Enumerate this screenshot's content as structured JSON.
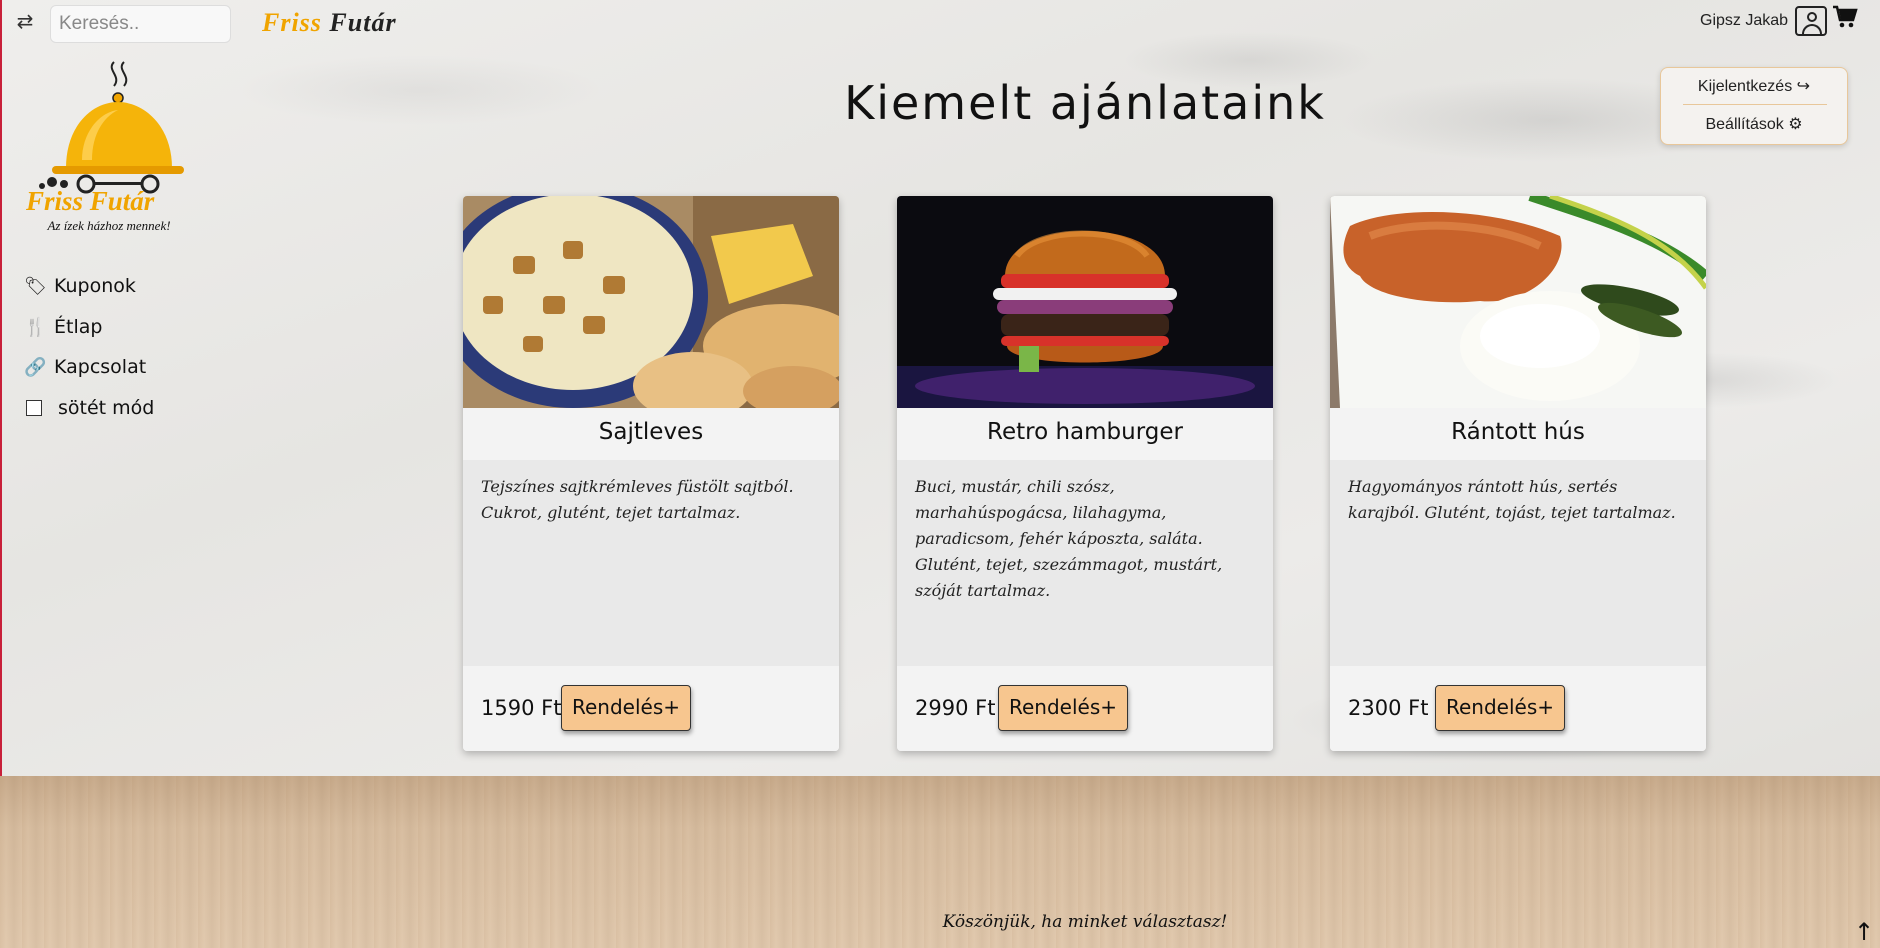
{
  "search": {
    "placeholder": "Keresés.."
  },
  "brand": {
    "part1": "Friss ",
    "part2": "Futár",
    "tagline": "Az ízek házhoz mennek!"
  },
  "user": {
    "name": "Gipsz Jakab"
  },
  "user_menu": {
    "logout": "Kijelentkezés",
    "settings": "Beállítások"
  },
  "sidebar": {
    "items": [
      {
        "label": "Kuponok",
        "icon": "tags-icon"
      },
      {
        "label": "Étlap",
        "icon": "utensils-icon"
      },
      {
        "label": "Kapcsolat",
        "icon": "link-icon"
      },
      {
        "label": "sötét mód",
        "icon": "checkbox"
      }
    ]
  },
  "main": {
    "title": "Kiemelt ajánlataink",
    "cards": [
      {
        "name": "Sajtleves",
        "description": "Tejszínes sajtkrémleves füstölt sajtból. Cukrot, glutént, tejet tartalmaz.",
        "price": "1590 Ft",
        "button": "Rendelés"
      },
      {
        "name": "Retro hamburger",
        "description": "Buci, mustár, chili szósz, marhahúspogácsa, lilahagyma, paradicsom, fehér káposzta, saláta. Glutént, tejet, szezámmagot, mustárt, szóját tartalmaz.",
        "price": "2990 Ft",
        "button": "Rendelés"
      },
      {
        "name": "Rántott hús",
        "description": "Hagyományos rántott hús, sertés karajból. Glutént, tojást, tejet tartalmaz.",
        "price": "2300 Ft",
        "button": "Rendelés"
      }
    ]
  },
  "footer": {
    "text": "Köszönjük, ha minket választasz!"
  },
  "colors": {
    "accent": "#f0a400",
    "button": "#f7c68f"
  }
}
